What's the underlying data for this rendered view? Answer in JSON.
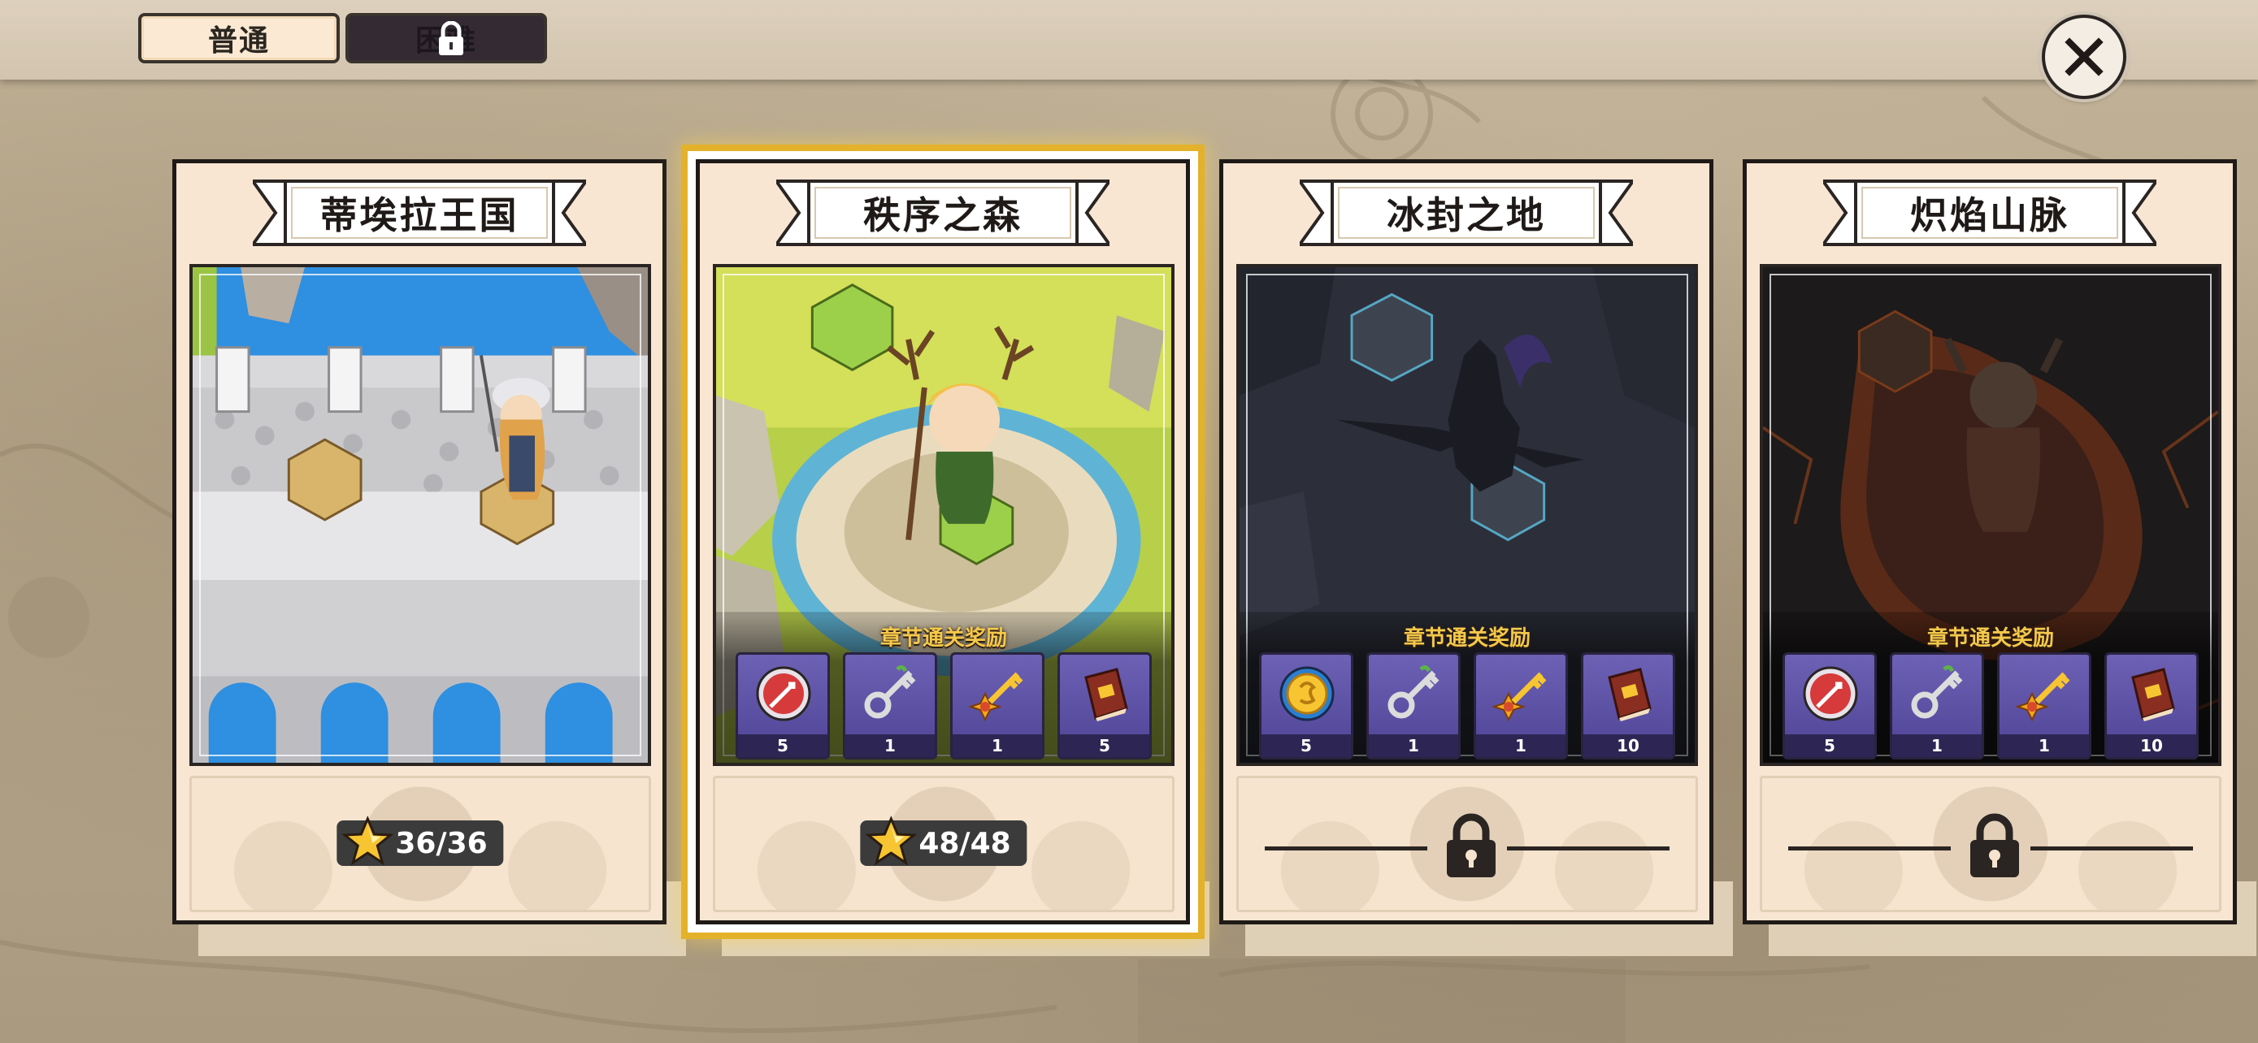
{
  "modes": {
    "normal": "普通",
    "hard": "困难",
    "hard_locked": true
  },
  "close_icon": "close-icon",
  "chapters": [
    {
      "title": "蒂埃拉王国",
      "selected": false,
      "locked": false,
      "rewards_visible": false,
      "stars": "36/36"
    },
    {
      "title": "秩序之森",
      "selected": true,
      "locked": false,
      "rewards_visible": true,
      "rewards_title": "章节通关奖励",
      "rewards": [
        {
          "icon": "red-compass-icon",
          "count": "5"
        },
        {
          "icon": "silver-key-icon",
          "count": "1"
        },
        {
          "icon": "gold-key-icon",
          "count": "1"
        },
        {
          "icon": "red-book-icon",
          "count": "5"
        }
      ],
      "stars": "48/48"
    },
    {
      "title": "冰封之地",
      "selected": false,
      "locked": true,
      "rewards_visible": true,
      "rewards_title": "章节通关奖励",
      "rewards": [
        {
          "icon": "gold-coin-icon",
          "count": "5"
        },
        {
          "icon": "silver-key-icon",
          "count": "1"
        },
        {
          "icon": "gold-key-icon",
          "count": "1"
        },
        {
          "icon": "red-book-icon",
          "count": "10"
        }
      ]
    },
    {
      "title": "炽焰山脉",
      "selected": false,
      "locked": true,
      "rewards_visible": true,
      "rewards_title": "章节通关奖励",
      "rewards": [
        {
          "icon": "red-compass-icon",
          "count": "5"
        },
        {
          "icon": "silver-key-icon",
          "count": "1"
        },
        {
          "icon": "gold-key-icon",
          "count": "1"
        },
        {
          "icon": "red-book-icon",
          "count": "10"
        }
      ]
    }
  ],
  "colors": {
    "accent_gold": "#e3b22a",
    "reward_bg": "#5d51a6",
    "rewards_title": "#f5c84b",
    "card_bg": "#f8e6d3"
  }
}
